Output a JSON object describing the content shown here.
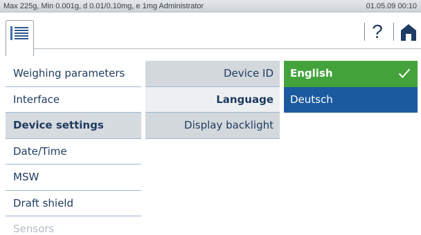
{
  "status_bar": {
    "info": "Max 225g, Min 0.001g, d 0.01/0.10mg, e 1mg  Administrator",
    "datetime": "01.05.09 00:10"
  },
  "toolbar": {
    "menu_icon": "list-document-icon",
    "help_label": "?",
    "home_icon": "home-icon"
  },
  "categories": [
    {
      "label": "Weighing parameters"
    },
    {
      "label": "Interface"
    },
    {
      "label": "Device settings"
    },
    {
      "label": "Date/Time"
    },
    {
      "label": "MSW"
    },
    {
      "label": "Draft shield"
    },
    {
      "label": "Sensors"
    }
  ],
  "settings": [
    {
      "label": "Device ID"
    },
    {
      "label": "Language"
    },
    {
      "label": "Display backlight"
    }
  ],
  "options": [
    {
      "label": "English",
      "selected": true
    },
    {
      "label": "Deutsch",
      "selected": false
    }
  ],
  "colors": {
    "selected_option": "#43a33a",
    "option": "#1c5aa0",
    "text": "#1e3a5f"
  }
}
